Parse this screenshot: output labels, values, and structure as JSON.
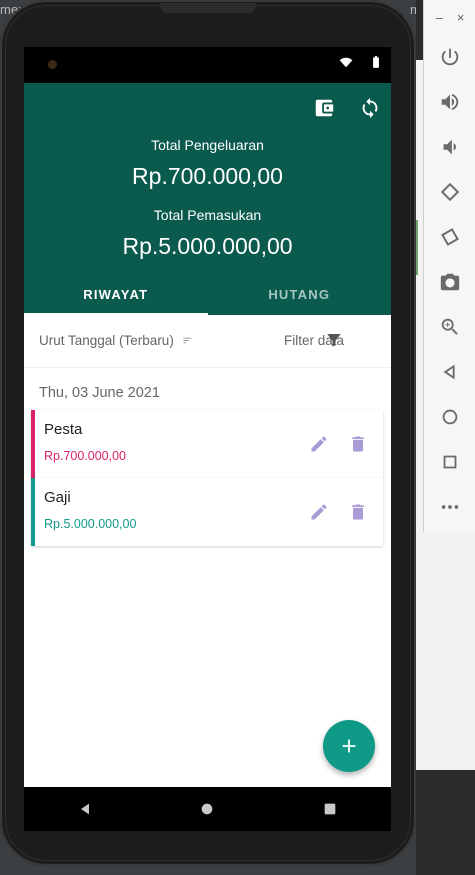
{
  "background": {
    "tab_left": "ment_",
    "tab_right": "ment_r"
  },
  "emulator": {
    "minimize": "–",
    "close": "×",
    "buttons": [
      "power-icon",
      "volume-up-icon",
      "volume-down-icon",
      "rotate-left-icon",
      "rotate-right-icon",
      "camera-icon",
      "zoom-icon",
      "back-icon",
      "home-icon",
      "overview-icon",
      "more-icon"
    ]
  },
  "header": {
    "total_pengeluaran_label": "Total Pengeluaran",
    "total_pengeluaran_value": "Rp.700.000,00",
    "total_pemasukan_label": "Total Pemasukan",
    "total_pemasukan_value": "Rp.5.000.000,00"
  },
  "tabs": [
    {
      "label": "RIWAYAT",
      "active": true
    },
    {
      "label": "HUTANG",
      "active": false
    }
  ],
  "filter": {
    "sort_label": "Urut Tanggal (Terbaru)",
    "filter_label": "Filter data"
  },
  "date_group": "Thu, 03 June 2021",
  "transactions": [
    {
      "title": "Pesta",
      "amount": "Rp.700.000,00",
      "color": "#d8226b"
    },
    {
      "title": "Gaji",
      "amount": "Rp.5.000.000,00",
      "color": "#11998e"
    }
  ],
  "colors": {
    "primary": "#0b5a4e",
    "accent": "#0e9a86",
    "expense": "#d8226b",
    "income": "#11998e",
    "action_icon": "#a99bd6"
  }
}
